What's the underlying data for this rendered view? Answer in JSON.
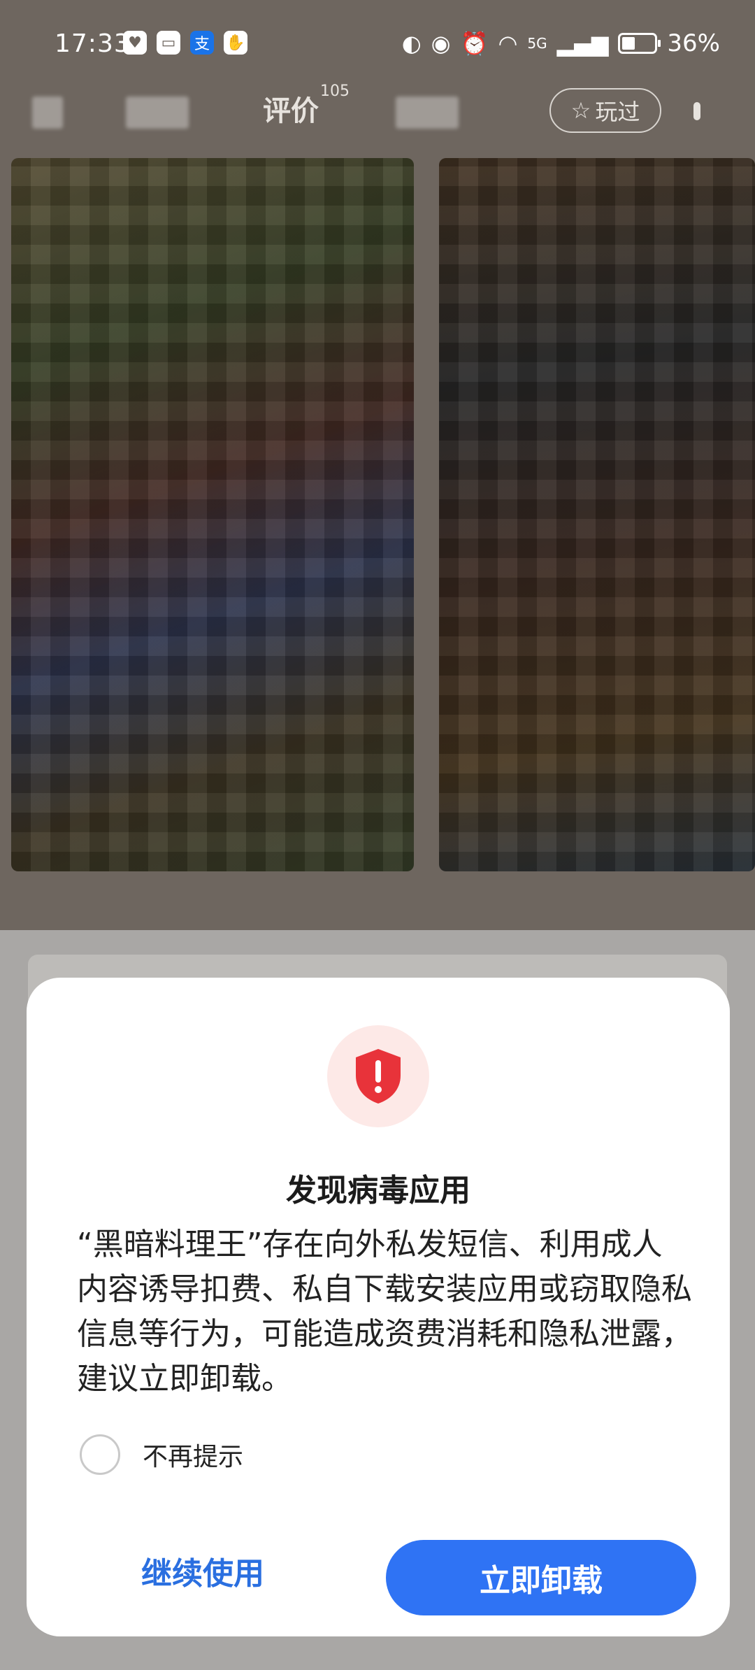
{
  "status_bar": {
    "time": "17:33",
    "network": "5G",
    "battery_percent": "36%",
    "battery_level": 0.36,
    "left_icons": [
      "heart-icon",
      "bag-icon",
      "alipay-icon",
      "hand-icon"
    ],
    "right_icons": [
      "nfc-icon",
      "eye-icon",
      "alarm-icon",
      "wifi-icon",
      "signal-icon",
      "battery-icon"
    ]
  },
  "background_app": {
    "tabs": [
      {
        "label": "评价",
        "count": "105"
      }
    ],
    "played_button": "玩过"
  },
  "dialog": {
    "title": "发现病毒应用",
    "message": "“黑暗料理王”存在向外私发短信、利用成人内容诱导扣费、私自下载安装应用或窃取隐私信息等行为，可能造成资费消耗和隐私泄露，建议立即卸载。",
    "checkbox_label": "不再提示",
    "continue_button": "继续使用",
    "uninstall_button": "立即卸载",
    "icon": "shield-warning-icon",
    "accent_color": "#2f73f4",
    "warning_color": "#e8333a"
  }
}
